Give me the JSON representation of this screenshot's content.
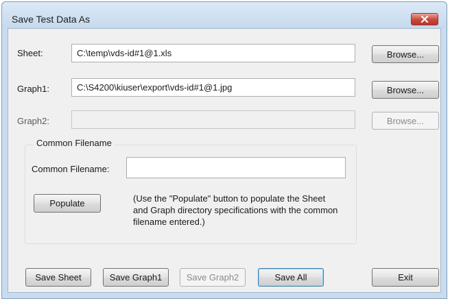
{
  "window": {
    "title": "Save Test Data As",
    "close_icon": "close-x-icon"
  },
  "sheet": {
    "label": "Sheet:",
    "value": "C:\\temp\\vds-id#1@1.xls",
    "browse_label": "Browse..."
  },
  "graph1": {
    "label": "Graph1:",
    "value": "C:\\S4200\\kiuser\\export\\vds-id#1@1.jpg",
    "browse_label": "Browse..."
  },
  "graph2": {
    "label": "Graph2:",
    "value": "",
    "browse_label": "Browse...",
    "enabled": false
  },
  "common": {
    "group_title": "Common Filename",
    "label": "Common Filename:",
    "value": "",
    "populate_label": "Populate",
    "hint": "(Use the \"Populate\" button to populate the Sheet and Graph directory specifications with the common filename entered.)"
  },
  "footer": {
    "save_sheet": "Save Sheet",
    "save_graph1": "Save Graph1",
    "save_graph2": "Save Graph2",
    "save_all": "Save All",
    "exit": "Exit"
  },
  "colors": {
    "close_button": "#c8483b",
    "client_background": "#f0f0f0",
    "frame": "#c9dcef"
  }
}
